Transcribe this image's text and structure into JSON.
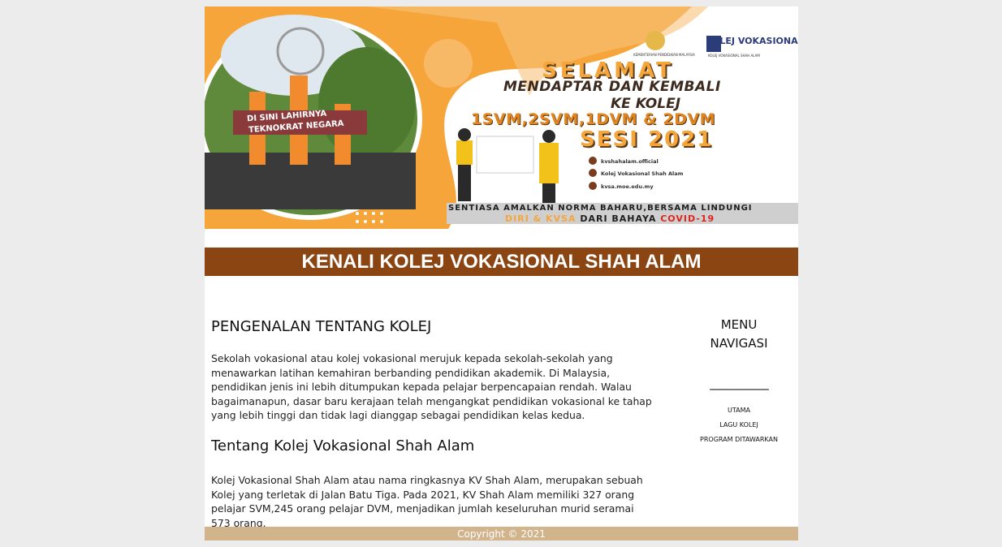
{
  "banner": {
    "selamat": "SELAMAT",
    "line2": "MENDAPTAR DAN KEMBALI",
    "line3": "KE KOLEJ",
    "line4": "1SVM,2SVM,1DVM & 2DVM",
    "sesi": "SESI 2021",
    "ministry_caption": "KEMENTERIAN PENDIDIKAN MALAYSIA",
    "kv_logo_text": "KOLEJ VOKASIONAL",
    "kv_logo_sub": "KOLEJ VOKASIONAL SHAH ALAM",
    "social": [
      "kvshahalam.official",
      "Kolej Vokasional Shah Alam",
      "kvsa.moe.edu.my"
    ],
    "sign_line1": "DI SINI LAHIRNYA",
    "sign_line2": "TEKNOKRAT NEGARA",
    "bar_line1": "SENTIASA AMALKAN NORMA BAHARU,BERSAMA LINDUNGI",
    "bar_line2_a": "DIRI & KVSA",
    "bar_line2_b": " DARI BAHAYA ",
    "bar_line2_c": "COVID-19",
    "colors": {
      "orange": "#f6a53a",
      "brown": "#8b4513",
      "tan": "#d2b48c"
    }
  },
  "header": {
    "title": "KENALI KOLEJ VOKASIONAL SHAH ALAM"
  },
  "main": {
    "section1_title": "PENGENALAN TENTANG KOLEJ",
    "section1_text": "Sekolah vokasional atau kolej vokasional merujuk kepada sekolah-sekolah yang menawarkan latihan kemahiran berbanding pendidikan akademik. Di Malaysia, pendidikan jenis ini lebih ditumpukan kepada pelajar berpencapaian rendah. Walau bagaimanapun, dasar baru kerajaan telah mengangkat pendidikan vokasional ke tahap yang lebih tinggi dan tidak lagi dianggap sebagai pendidikan kelas kedua.",
    "section2_title": "Tentang Kolej Vokasional Shah Alam",
    "section2_text": "Kolej Vokasional Shah Alam atau nama ringkasnya KV Shah Alam, merupakan sebuah Kolej yang terletak di Jalan Batu Tiga. Pada 2021, KV Shah Alam memiliki 327 orang pelajar SVM,245 orang pelajar DVM, menjadikan jumlah keseluruhan murid seramai 573 orang."
  },
  "sidebar": {
    "title_line1": "MENU",
    "title_line2": "NAVIGASI",
    "rule": "___________",
    "links": [
      "UTAMA",
      "LAGU KOLEJ",
      "PROGRAM DITAWARKAN"
    ]
  },
  "footer": {
    "text": "Copyright © 2021"
  }
}
